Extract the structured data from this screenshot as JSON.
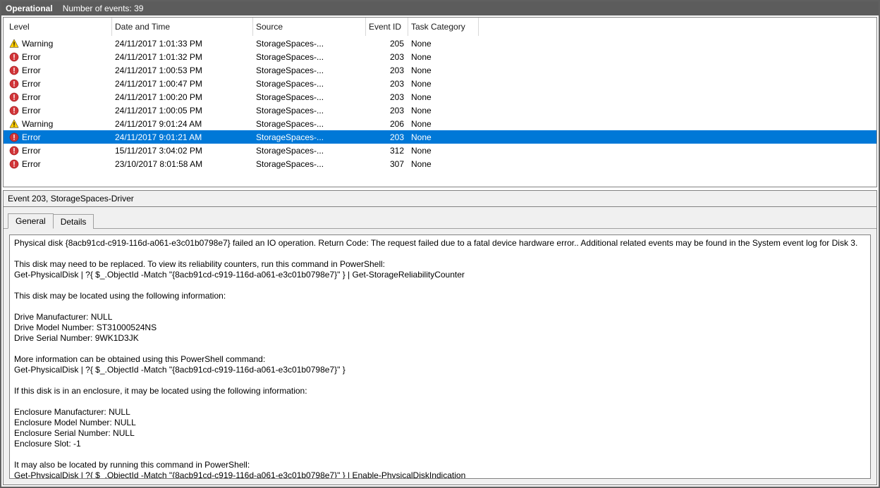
{
  "titlebar": {
    "name": "Operational",
    "count_label": "Number of events: 39"
  },
  "columns": {
    "level": "Level",
    "datetime": "Date and Time",
    "source": "Source",
    "event_id": "Event ID",
    "task": "Task Category"
  },
  "rows": [
    {
      "icon": "warn",
      "level": "Warning",
      "dt": "24/11/2017 1:01:33 PM",
      "source": "StorageSpaces-...",
      "eid": "205",
      "task": "None",
      "selected": false
    },
    {
      "icon": "error",
      "level": "Error",
      "dt": "24/11/2017 1:01:32 PM",
      "source": "StorageSpaces-...",
      "eid": "203",
      "task": "None",
      "selected": false
    },
    {
      "icon": "error",
      "level": "Error",
      "dt": "24/11/2017 1:00:53 PM",
      "source": "StorageSpaces-...",
      "eid": "203",
      "task": "None",
      "selected": false
    },
    {
      "icon": "error",
      "level": "Error",
      "dt": "24/11/2017 1:00:47 PM",
      "source": "StorageSpaces-...",
      "eid": "203",
      "task": "None",
      "selected": false
    },
    {
      "icon": "error",
      "level": "Error",
      "dt": "24/11/2017 1:00:20 PM",
      "source": "StorageSpaces-...",
      "eid": "203",
      "task": "None",
      "selected": false
    },
    {
      "icon": "error",
      "level": "Error",
      "dt": "24/11/2017 1:00:05 PM",
      "source": "StorageSpaces-...",
      "eid": "203",
      "task": "None",
      "selected": false
    },
    {
      "icon": "warn",
      "level": "Warning",
      "dt": "24/11/2017 9:01:24 AM",
      "source": "StorageSpaces-...",
      "eid": "206",
      "task": "None",
      "selected": false
    },
    {
      "icon": "errsel",
      "level": "Error",
      "dt": "24/11/2017 9:01:21 AM",
      "source": "StorageSpaces-...",
      "eid": "203",
      "task": "None",
      "selected": true
    },
    {
      "icon": "error",
      "level": "Error",
      "dt": "15/11/2017 3:04:02 PM",
      "source": "StorageSpaces-...",
      "eid": "312",
      "task": "None",
      "selected": false
    },
    {
      "icon": "error",
      "level": "Error",
      "dt": "23/10/2017 8:01:58 AM",
      "source": "StorageSpaces-...",
      "eid": "307",
      "task": "None",
      "selected": false
    }
  ],
  "detail": {
    "header": "Event 203, StorageSpaces-Driver",
    "tabs": {
      "general": "General",
      "details": "Details"
    },
    "body": "Physical disk {8acb91cd-c919-116d-a061-e3c01b0798e7} failed an IO operation. Return Code: The request failed due to a fatal device hardware error.. Additional related events may be found in the System event log for Disk 3.\n\nThis disk may need to be replaced. To view its reliability counters, run this command in PowerShell:\nGet-PhysicalDisk | ?{ $_.ObjectId -Match \"{8acb91cd-c919-116d-a061-e3c01b0798e7}\" } | Get-StorageReliabilityCounter\n\nThis disk may be located using the following information:\n\nDrive Manufacturer: NULL\nDrive Model Number: ST31000524NS\nDrive Serial Number: 9WK1D3JK\n\nMore information can be obtained using this PowerShell command:\nGet-PhysicalDisk | ?{ $_.ObjectId -Match \"{8acb91cd-c919-116d-a061-e3c01b0798e7}\" }\n\nIf this disk is in an enclosure, it may be located using the following information:\n\nEnclosure Manufacturer: NULL\nEnclosure Model Number: NULL\nEnclosure Serial Number: NULL\nEnclosure Slot: -1\n\nIt may also be located by running this command in PowerShell:\nGet-PhysicalDisk | ?{ $_.ObjectId -Match \"{8acb91cd-c919-116d-a061-e3c01b0798e7}\" } | Enable-PhysicalDiskIndication"
  }
}
